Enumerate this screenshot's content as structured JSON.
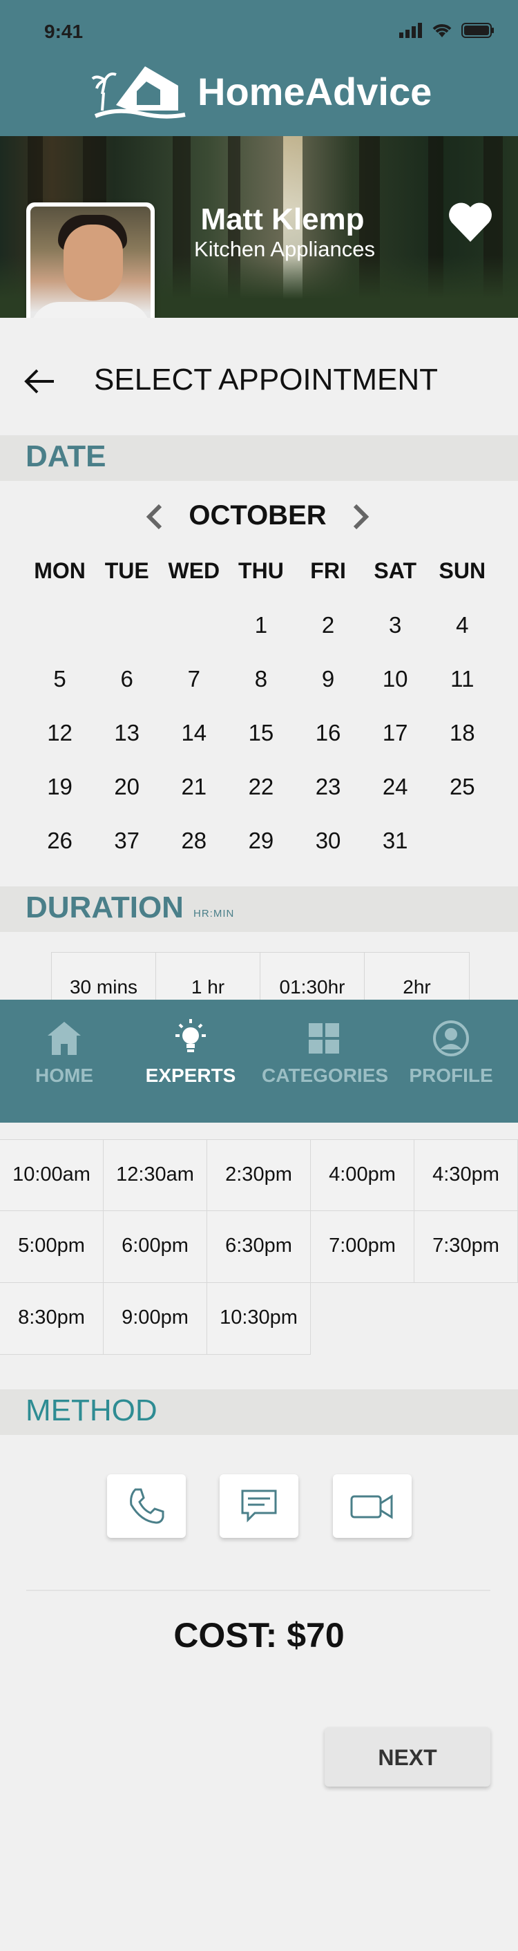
{
  "status_bar": {
    "time": "9:41"
  },
  "app": {
    "brand": "HomeAdvice",
    "brand_color": "#4a7f89"
  },
  "pro": {
    "name": "Matt Klemp",
    "category": "Kitchen Appliances"
  },
  "page": {
    "title": "SELECT APPOINTMENT"
  },
  "date_section": {
    "title": "DATE",
    "month": "OCTOBER",
    "weekdays": [
      "MON",
      "TUE",
      "WED",
      "THU",
      "FRI",
      "SAT",
      "SUN"
    ],
    "weeks": [
      [
        "",
        "",
        "",
        "1",
        "2",
        "3",
        "4"
      ],
      [
        "5",
        "6",
        "7",
        "8",
        "9",
        "10",
        "11"
      ],
      [
        "12",
        "13",
        "14",
        "15",
        "16",
        "17",
        "18"
      ],
      [
        "19",
        "20",
        "21",
        "22",
        "23",
        "24",
        "25"
      ],
      [
        "26",
        "37",
        "28",
        "29",
        "30",
        "31",
        ""
      ]
    ]
  },
  "duration_section": {
    "title": "DURATION",
    "unit": "HR:MIN",
    "options": [
      "30 mins",
      "1 hr",
      "01:30hr",
      "2hr"
    ]
  },
  "tabbar": {
    "items": [
      {
        "label": "HOME",
        "icon": "home-icon",
        "active": false
      },
      {
        "label": "EXPERTS",
        "icon": "lightbulb-icon",
        "active": true
      },
      {
        "label": "CATEGORIES",
        "icon": "grid-icon",
        "active": false
      },
      {
        "label": "PROFILE",
        "icon": "profile-icon",
        "active": false
      }
    ]
  },
  "time_slots": [
    [
      "10:00am",
      "12:30am",
      "2:30pm",
      "4:00pm",
      "4:30pm"
    ],
    [
      "5:00pm",
      "6:00pm",
      "6:30pm",
      "7:00pm",
      "7:30pm"
    ],
    [
      "8:30pm",
      "9:00pm",
      "10:30pm"
    ]
  ],
  "method_section": {
    "title": "METHOD",
    "options": [
      {
        "name": "phone",
        "icon": "phone-icon"
      },
      {
        "name": "message",
        "icon": "chat-icon"
      },
      {
        "name": "video",
        "icon": "video-icon"
      }
    ]
  },
  "cost": {
    "label": "COST:",
    "value": "$70"
  },
  "next_button": {
    "label": "NEXT"
  }
}
